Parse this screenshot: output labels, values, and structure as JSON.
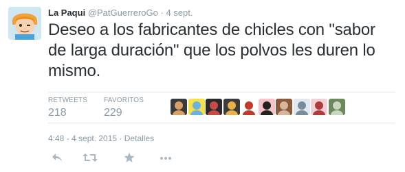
{
  "tweet": {
    "author_name": "La Paqui",
    "author_handle": "@PatGuerreroGo",
    "separator": "·",
    "date_short": "4 sept.",
    "text": "Deseo a los fabricantes de chicles con \"sabor de larga duración\" que los polvos les duren lo mismo.",
    "retweets_label": "RETWEETS",
    "retweets_count": "218",
    "favorites_label": "FAVORITOS",
    "favorites_count": "229",
    "timestamp": "4:48 - 4 sept. 2015",
    "details_label": "Detalles"
  },
  "favoriters": [
    {
      "bg": "#3a3a3a",
      "fg": "#d9a066"
    },
    {
      "bg": "#f3e04a",
      "fg": "#6db1e0"
    },
    {
      "bg": "#2a2a2a",
      "fg": "#c94a4a"
    },
    {
      "bg": "#3b3b3b",
      "fg": "#e8b04a"
    },
    {
      "bg": "#ffffff",
      "fg": "#c0392b"
    },
    {
      "bg": "#f6c3c8",
      "fg": "#222222"
    },
    {
      "bg": "#8a5a3c",
      "fg": "#d8b49a"
    },
    {
      "bg": "#dfe8ef",
      "fg": "#7a8c9a"
    },
    {
      "bg": "#f2d1d6",
      "fg": "#b13a3a"
    },
    {
      "bg": "#6a8a5c",
      "fg": "#c9d6c0"
    }
  ],
  "colors": {
    "text": "#292f33",
    "muted": "#8899a6",
    "divider": "#e1e8ed",
    "icon": "#aab8c2"
  },
  "icons": {
    "reply": "reply-icon",
    "retweet": "retweet-icon",
    "favorite": "star-icon",
    "more": "more-icon"
  }
}
